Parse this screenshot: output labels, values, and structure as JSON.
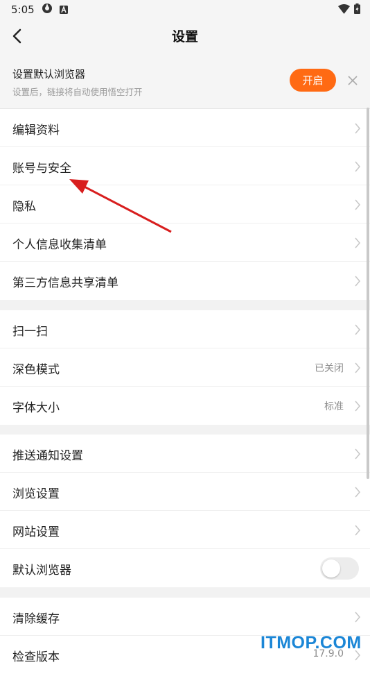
{
  "status": {
    "time": "5:05"
  },
  "header": {
    "title": "设置"
  },
  "banner": {
    "title": "设置默认浏览器",
    "subtitle": "设置后，链接将自动使用悟空打开",
    "button": "开启"
  },
  "groups": [
    {
      "items": [
        {
          "label": "编辑资料"
        },
        {
          "label": "账号与安全"
        },
        {
          "label": "隐私"
        },
        {
          "label": "个人信息收集清单"
        },
        {
          "label": "第三方信息共享清单"
        }
      ]
    },
    {
      "items": [
        {
          "label": "扫一扫"
        },
        {
          "label": "深色模式",
          "value": "已关闭"
        },
        {
          "label": "字体大小",
          "value": "标准"
        }
      ]
    },
    {
      "items": [
        {
          "label": "推送通知设置"
        },
        {
          "label": "浏览设置"
        },
        {
          "label": "网站设置"
        },
        {
          "label": "默认浏览器",
          "toggle": "off"
        }
      ]
    },
    {
      "items": [
        {
          "label": "清除缓存"
        },
        {
          "label": "检查版本",
          "value": "17.9.0"
        }
      ]
    }
  ],
  "watermark": "ITMOP.COM"
}
